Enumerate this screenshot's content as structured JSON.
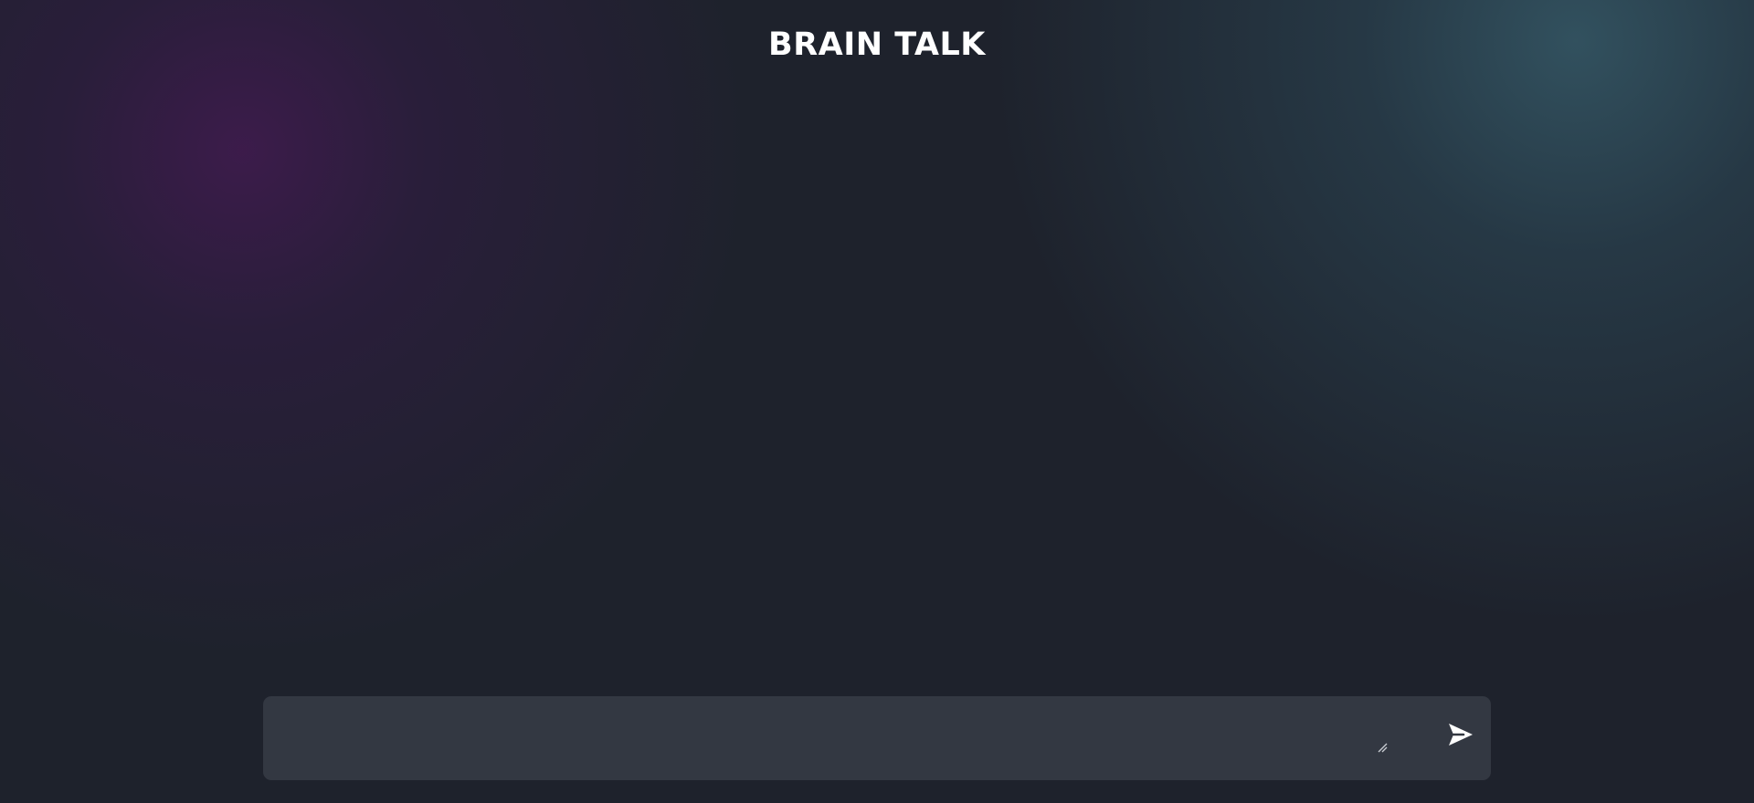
{
  "header": {
    "title": "BRAIN TALK"
  },
  "composer": {
    "input_value": "",
    "placeholder": "",
    "send_icon": "send-icon",
    "resize_icon": "resize-handle-icon"
  },
  "colors": {
    "background": "#1e222c",
    "composer_background": "#333842",
    "title_text": "#ffffff",
    "accent_purple": "#3a1d4f",
    "accent_teal": "#2e4a58"
  }
}
